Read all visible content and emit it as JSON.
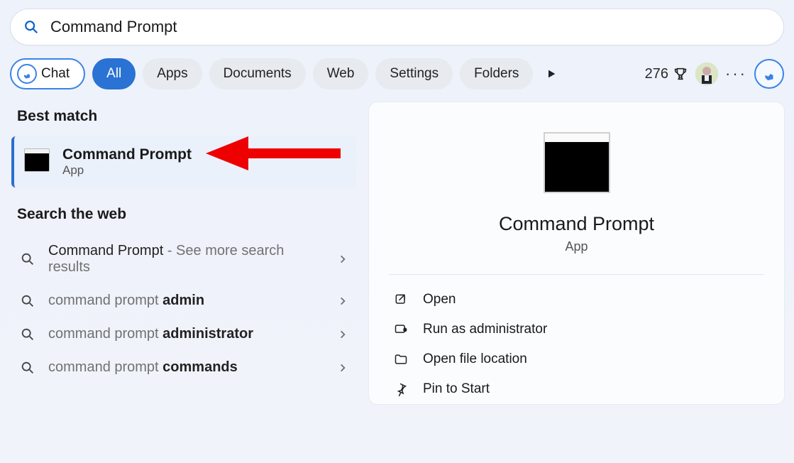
{
  "search": {
    "value": "Command Prompt"
  },
  "filters": {
    "chat": "Chat",
    "all": "All",
    "apps": "Apps",
    "documents": "Documents",
    "web": "Web",
    "settings": "Settings",
    "folders": "Folders"
  },
  "points": {
    "value": "276"
  },
  "sections": {
    "bestMatch": "Best match",
    "searchWeb": "Search the web"
  },
  "bestMatch": {
    "title": "Command Prompt",
    "subtitle": "App"
  },
  "webResults": [
    {
      "prefix": "Command Prompt",
      "suffix": " - See more search results",
      "bold": ""
    },
    {
      "prefix": "command prompt ",
      "suffix": "",
      "bold": "admin"
    },
    {
      "prefix": "command prompt ",
      "suffix": "",
      "bold": "administrator"
    },
    {
      "prefix": "command prompt ",
      "suffix": "",
      "bold": "commands"
    }
  ],
  "preview": {
    "title": "Command Prompt",
    "subtitle": "App",
    "actions": {
      "open": "Open",
      "runAdmin": "Run as administrator",
      "openLoc": "Open file location",
      "pin": "Pin to Start"
    }
  }
}
